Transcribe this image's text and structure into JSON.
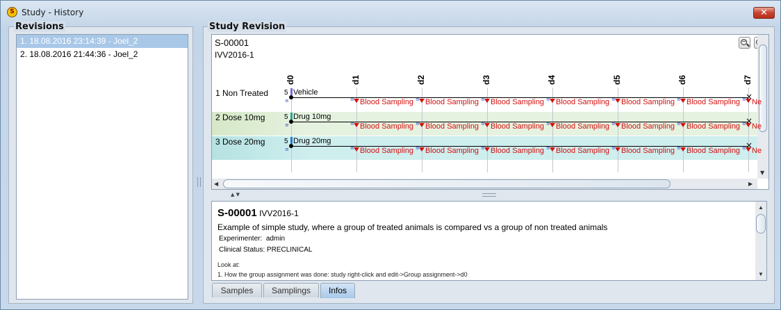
{
  "window": {
    "title": "Study - History",
    "close_label": "✕"
  },
  "revisions": {
    "title": "Revisions",
    "items": [
      {
        "label": "1. 18.08.2016 23:14:39 - Joel_2",
        "selected": true
      },
      {
        "label": "2. 18.08.2016 21:44:36 - Joel_2",
        "selected": false
      }
    ]
  },
  "study_revision": {
    "title": "Study Revision",
    "study_id": "S-00001",
    "study_name": "IVV2016-1",
    "days": [
      "d0",
      "d1",
      "d2",
      "d3",
      "d4",
      "d5",
      "d6",
      "d7"
    ],
    "groups": [
      {
        "label": "1 Non Treated",
        "n": "5",
        "treatment": "Vehicle",
        "treat_color": "#7b6bd0",
        "band": "#ffffff"
      },
      {
        "label": "2 Dose 10mg",
        "n": "5",
        "treatment": "Drug 10mg",
        "treat_color": "#2aa3a0",
        "band": "#e6f2e0"
      },
      {
        "label": "3 Dose 20mg",
        "n": "5",
        "treatment": "Drug 20mg",
        "treat_color": "#2a7ad0",
        "band": "#cfeeee"
      }
    ],
    "event_label": "Blood Sampling",
    "cut_label": "Ne"
  },
  "info": {
    "study_id": "S-00001",
    "study_name": "IVV2016-1",
    "description": "Example of simple study, where a group of treated animals is compared vs a group of non treated animals",
    "experimenter_label": "Experimenter:",
    "experimenter": "admin",
    "clinical_status_label": "Clinical Status:",
    "clinical_status": "PRECLINICAL",
    "look_at": "Look at:",
    "note_1": "1. How the group assignment was done: study right-click and edit->Group assignment->d0"
  },
  "tabs": [
    {
      "label": "Samples",
      "active": false
    },
    {
      "label": "Samplings",
      "active": false
    },
    {
      "label": "Infos",
      "active": true
    }
  ],
  "colors": {
    "event": "#d41010",
    "selection": "#a9c8e8"
  },
  "icons": [
    "app-icon",
    "close-icon",
    "zoom-out-icon",
    "zoom-in-icon"
  ]
}
